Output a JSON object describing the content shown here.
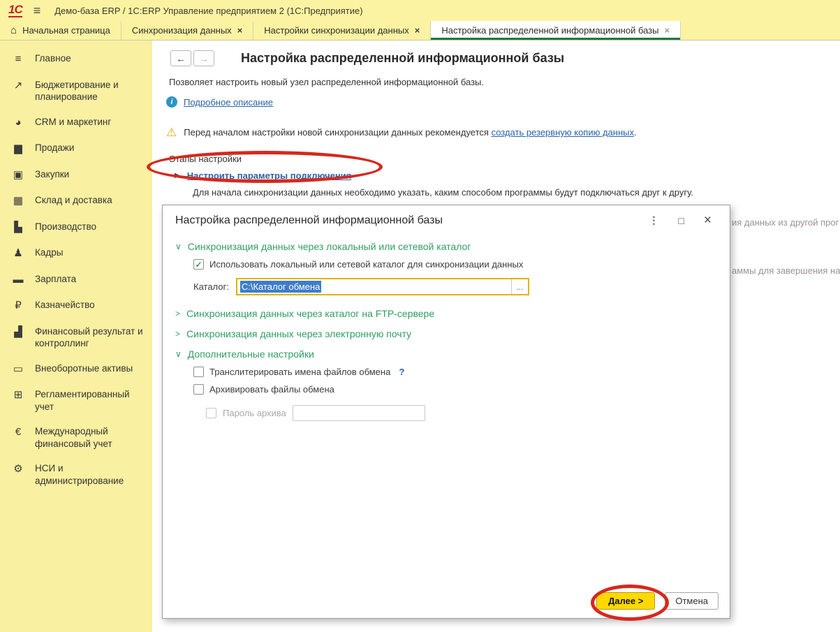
{
  "window": {
    "logo": "1С",
    "title": "Демо-база ERP / 1С:ERP Управление предприятием 2  (1С:Предприятие)"
  },
  "icons": {
    "hamburger": "≡",
    "home": "⌂",
    "close": "×",
    "back": "←",
    "forward": "→",
    "info": "i",
    "warning": "⚠",
    "step_arrow": "▶",
    "chevron_down": "∨",
    "chevron_right": ">",
    "check": "✓",
    "help": "?",
    "kebab": "⋮",
    "maximize": "□",
    "dialog_close": "×",
    "browse": "...",
    "menu": "≡",
    "trend": "↗",
    "pie": "◕",
    "briefcase": "▆",
    "cart": "▣",
    "grid": "▦",
    "factory": "▙",
    "person": "♟",
    "card": "▬",
    "ruble": "₽",
    "chart": "▟",
    "truck": "▭",
    "calculator": "⊞",
    "euro": "€",
    "gear": "⚙"
  },
  "tabs": [
    {
      "label": "Начальная страница"
    },
    {
      "label": "Синхронизация данных"
    },
    {
      "label": "Настройки синхронизации данных"
    },
    {
      "label": "Настройка распределенной информационной базы"
    }
  ],
  "sidebar": {
    "items": [
      {
        "label": "Главное"
      },
      {
        "label": "Бюджетирование и планирование"
      },
      {
        "label": "CRM и маркетинг"
      },
      {
        "label": "Продажи"
      },
      {
        "label": "Закупки"
      },
      {
        "label": "Склад и доставка"
      },
      {
        "label": "Производство"
      },
      {
        "label": "Кадры"
      },
      {
        "label": "Зарплата"
      },
      {
        "label": "Казначейство"
      },
      {
        "label": "Финансовый результат и контроллинг"
      },
      {
        "label": "Внеоборотные активы"
      },
      {
        "label": "Регламентированный учет"
      },
      {
        "label": "Международный финансовый учет"
      },
      {
        "label": "НСИ и администрирование"
      }
    ]
  },
  "page": {
    "title": "Настройка распределенной информационной базы",
    "subtitle": "Позволяет настроить новый узел распределенной информационной базы.",
    "info_link": "Подробное описание",
    "warning_prefix": "Перед началом настройки новой синхронизации данных рекомендуется ",
    "warning_link": "создать резервную копию данных",
    "warning_suffix": ".",
    "stages_heading": "Этапы настройки",
    "step_link": "Настроить параметры подключения",
    "step_desc": "Для начала синхронизации данных необходимо указать, каким способом программы будут подключаться друг к другу.",
    "bg_fragment_1": "ия данных из другой прог",
    "bg_fragment_2": "аммы для завершения нас"
  },
  "dialog": {
    "title": "Настройка распределенной информационной базы",
    "section_local": "Синхронизация данных через локальный или сетевой каталог",
    "checkbox_use_local": "Использовать локальный или сетевой каталог для синхронизации данных",
    "catalog_label": "Каталог:",
    "catalog_value": "C:\\Каталог обмена",
    "section_ftp": "Синхронизация данных через каталог на FTP-сервере",
    "section_email": "Синхронизация данных через электронную почту",
    "section_extra": "Дополнительные настройки",
    "checkbox_translit": "Транслитерировать имена файлов обмена",
    "checkbox_archive": "Архивировать файлы обмена",
    "checkbox_password": "Пароль архива",
    "password_value": "",
    "next_button": "Далее >",
    "cancel_button": "Отмена"
  },
  "colors": {
    "topbar_yellow": "#fbf3a2",
    "sidebar_yellow": "#f9f0a1",
    "active_tab_green": "#1d7a44",
    "section_green": "#2f9e62",
    "link_blue": "#2b62a7",
    "annotation_red": "#d6281e",
    "selection_blue": "#3d7dc8",
    "field_border_gold": "#e0b400",
    "next_button_yellow": "#ffd800",
    "logo_red": "#cc1f1a",
    "warning_yellow": "#e8a818",
    "info_blue": "#2d94c4"
  }
}
